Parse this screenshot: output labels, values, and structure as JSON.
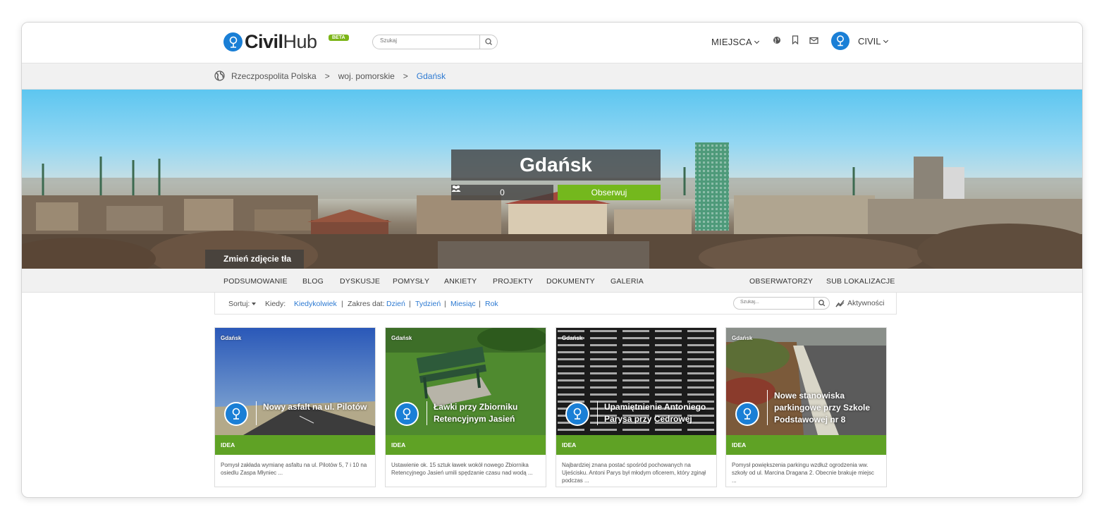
{
  "header": {
    "logo_text": "Civil",
    "logo_text_hub": "Hub",
    "beta_badge": "BETA",
    "search_placeholder": "Szukaj",
    "places_menu": "MIEJSCA",
    "user_name": "CIVIL",
    "icons": [
      "globe-icon",
      "bookmark-icon",
      "envelope-icon"
    ]
  },
  "breadcrumb": {
    "items": [
      "Rzeczpospolita Polska",
      "woj. pomorskie",
      "Gdańsk"
    ],
    "separator": ">"
  },
  "hero": {
    "title": "Gdańsk",
    "followers_count": "0",
    "follow_button": "Obserwuj",
    "change_background": "Zmień zdjęcie tła"
  },
  "tabs": {
    "left": [
      "PODSUMOWANIE",
      "BLOG",
      "DYSKUSJE",
      "POMYSŁY",
      "ANKIETY",
      "PROJEKTY",
      "DOKUMENTY",
      "GALERIA"
    ],
    "right": [
      "OBSERWATORZY",
      "SUB LOKALIZACJE"
    ]
  },
  "filter": {
    "sort_label": "Sortuj:",
    "when_label": "Kiedy:",
    "when_value": "Kiedykolwiek",
    "range_label": "Zakres dat:",
    "ranges": [
      "Dzień",
      "Tydzień",
      "Miesiąc",
      "Rok"
    ],
    "divider": "|",
    "search_placeholder": "Szukaj...",
    "activity_label": "Aktywności"
  },
  "cards": [
    {
      "location": "Gdańsk",
      "title": "Nowy asfalt na ul. Pilotów",
      "tag": "IDEA",
      "description": "Pomysł zakłada wymianę asfaltu na ul. Pilotów 5, 7 i 10 na osiedlu Zaspa Młyniec ..."
    },
    {
      "location": "Gdańsk",
      "title": "Ławki przy Zbiorniku Retencyjnym Jasień",
      "tag": "IDEA",
      "description": "Ustawienie ok. 15 sztuk ławek wokół nowego Zbiornika Retencyjnego Jasień umili spędzanie czasu nad wodą ..."
    },
    {
      "location": "Gdańsk",
      "title": "Upamiętnienie Antoniego Parysa przy Cedrowej",
      "tag": "IDEA",
      "description": "Najbardziej znana postać spośród pochowanych na Ujeścisku. Antoni Parys był młodym oficerem, który zginął podczas ..."
    },
    {
      "location": "Gdańsk",
      "title": "Nowe stanowiska parkingowe przy Szkole Podstawowej nr 8",
      "tag": "IDEA",
      "description": "Pomysł powiększenia parkingu wzdłuż ogrodzenia ww. szkoły od ul. Marcina Dragana 2. Obecnie brakuje miejsc ..."
    }
  ],
  "colors": {
    "brand_blue": "#1a7fd6",
    "link_blue": "#2d7ad2",
    "follow_green": "#74b81d",
    "tag_green": "#5fa225"
  }
}
